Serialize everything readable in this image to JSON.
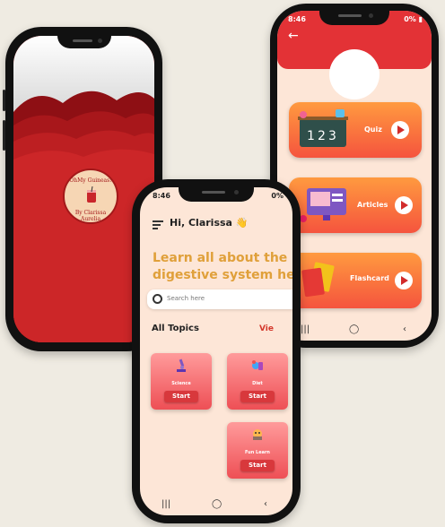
{
  "splash": {
    "logo_top": "OhMy Guineas!",
    "logo_bottom": "By Clarissa Aurelia"
  },
  "home": {
    "status_time": "8:46",
    "status_right": "0%",
    "greeting": "Hi, Clarissa 👋",
    "headline_line1": "Learn all about the",
    "headline_line2": "digestive system he",
    "search_placeholder": "Search here",
    "section_title": "All Topics",
    "view_all": "Vie",
    "topics": [
      {
        "name": "Science",
        "start": "Start"
      },
      {
        "name": "Diet",
        "start": "Start"
      },
      {
        "name": "Fun Learn",
        "start": "Start"
      }
    ],
    "nav": {
      "recent": "|||",
      "home": "◯",
      "back": "‹"
    }
  },
  "menu": {
    "status_time": "8:46",
    "status_right": "0% ▮",
    "back": "←",
    "cards": [
      {
        "label": "Quiz"
      },
      {
        "label": "Articles"
      },
      {
        "label": "Flashcard"
      }
    ],
    "nav": {
      "recent": "|||",
      "home": "◯",
      "back": "‹"
    }
  },
  "colors": {
    "primary_red": "#d12a2a",
    "accent_orange": "#e0a03a",
    "card_gradient_top": "#ff9a3f",
    "card_gradient_bottom": "#f5543e",
    "background": "#efebe2"
  }
}
